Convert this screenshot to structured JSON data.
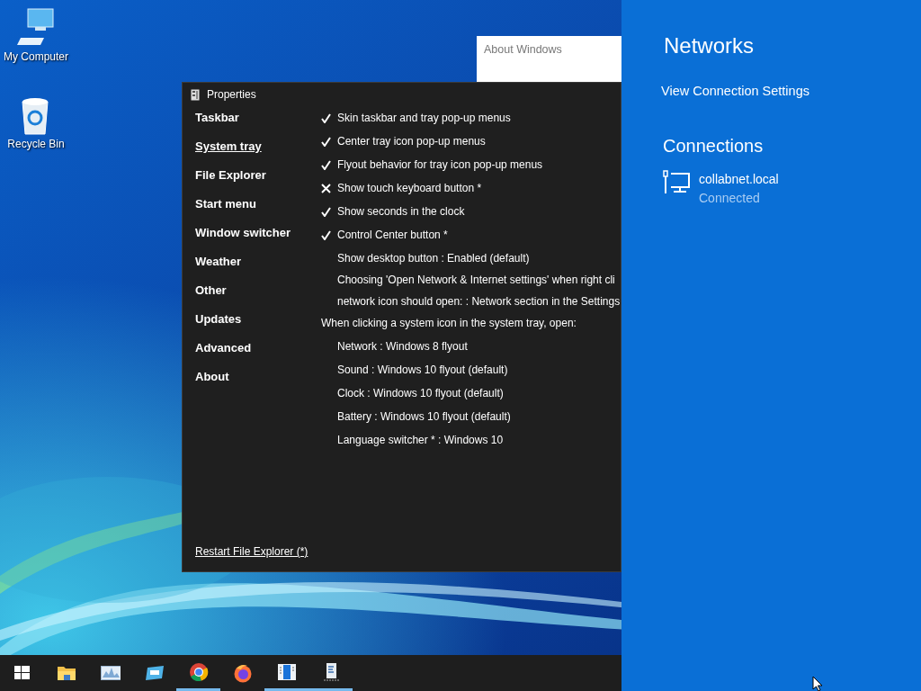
{
  "desktop_icons": [
    {
      "kind": "computer",
      "label": "My Computer"
    },
    {
      "kind": "recycle",
      "label": "Recycle Bin"
    }
  ],
  "about_window": {
    "title": "About Windows"
  },
  "properties_window": {
    "title": "Properties",
    "sidebar": [
      {
        "label": "Taskbar",
        "selected": false
      },
      {
        "label": "System tray",
        "selected": true
      },
      {
        "label": "File Explorer",
        "selected": false
      },
      {
        "label": "Start menu",
        "selected": false
      },
      {
        "label": "Window switcher",
        "selected": false
      },
      {
        "label": "Weather",
        "selected": false
      },
      {
        "label": "Other",
        "selected": false
      },
      {
        "label": "Updates",
        "selected": false
      },
      {
        "label": "Advanced",
        "selected": false
      },
      {
        "label": "About",
        "selected": false
      }
    ],
    "options": [
      {
        "kind": "check",
        "label": "Skin taskbar and tray pop-up menus",
        "checked": true
      },
      {
        "kind": "check",
        "label": "Center tray icon pop-up menus",
        "checked": true
      },
      {
        "kind": "check",
        "label": "Flyout behavior for tray icon pop-up menus",
        "checked": true
      },
      {
        "kind": "check",
        "label": "Show touch keyboard button *",
        "checked": false
      },
      {
        "kind": "check",
        "label": "Show seconds in the clock",
        "checked": true
      },
      {
        "kind": "check",
        "label": "Control Center button *",
        "checked": true
      },
      {
        "kind": "setting",
        "label": "Show desktop button : Enabled (default)"
      },
      {
        "kind": "setting",
        "label": "Choosing 'Open Network & Internet settings' when right cli",
        "continuation": "network icon should open: : Network section in the Settings"
      },
      {
        "kind": "heading",
        "label": "When clicking a system icon in the system tray, open:"
      },
      {
        "kind": "setting",
        "label": "Network : Windows 8 flyout"
      },
      {
        "kind": "setting",
        "label": "Sound : Windows 10 flyout (default)"
      },
      {
        "kind": "setting",
        "label": "Clock : Windows 10 flyout (default)"
      },
      {
        "kind": "setting",
        "label": "Battery : Windows 10 flyout (default)"
      },
      {
        "kind": "setting",
        "label": "Language switcher * : Windows 10"
      }
    ],
    "footer_link": "Restart File Explorer (*)"
  },
  "taskbar": [
    {
      "kind": "start",
      "running": false
    },
    {
      "kind": "folder",
      "running": false
    },
    {
      "kind": "chart",
      "running": false
    },
    {
      "kind": "window",
      "running": false
    },
    {
      "kind": "chrome",
      "running": true
    },
    {
      "kind": "firefox",
      "running": false
    },
    {
      "kind": "panel",
      "running": true
    },
    {
      "kind": "document",
      "running": true
    }
  ],
  "network_flyout": {
    "title": "Networks",
    "link": "View Connection Settings",
    "section": "Connections",
    "connections": [
      {
        "name": "collabnet.local",
        "status": "Connected"
      }
    ]
  }
}
